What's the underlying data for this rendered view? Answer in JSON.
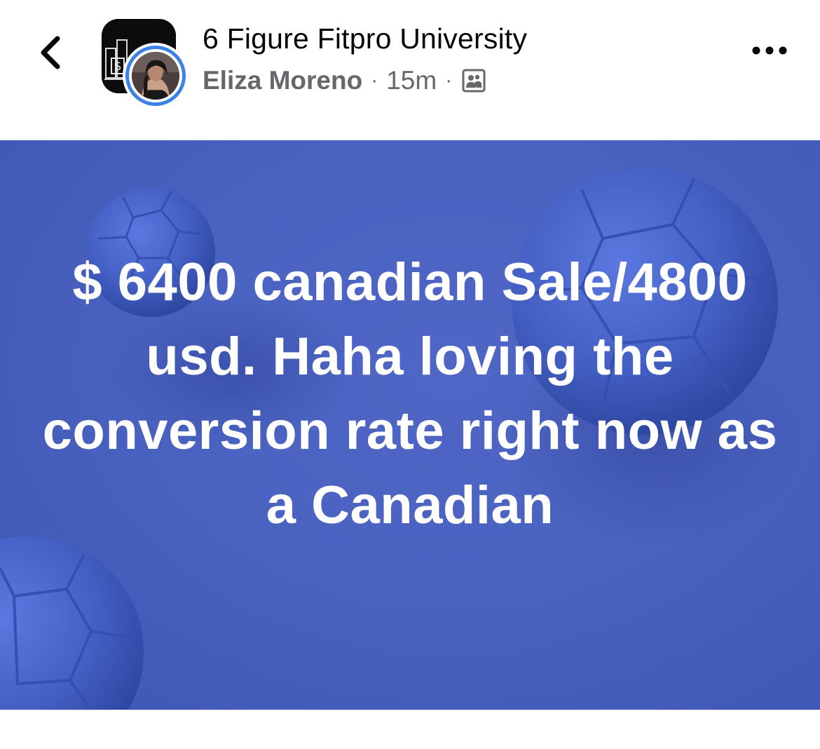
{
  "header": {
    "group_name": "6 Figure Fitpro University",
    "author_name": "Eliza Moreno",
    "time_ago": "15m",
    "separator": "·",
    "icons": {
      "back": "chevron-left-icon",
      "audience": "group-members-icon",
      "more": "more-options-icon"
    }
  },
  "post": {
    "text": "$ 6400 canadian Sale/4800 usd. Haha loving the conversion rate right now as a Canadian",
    "background_color": "#4a62c0",
    "text_color": "#ffffff"
  },
  "colors": {
    "avatar_ring": "#3b82e6",
    "meta_text": "#65676b",
    "title_text": "#050505"
  }
}
